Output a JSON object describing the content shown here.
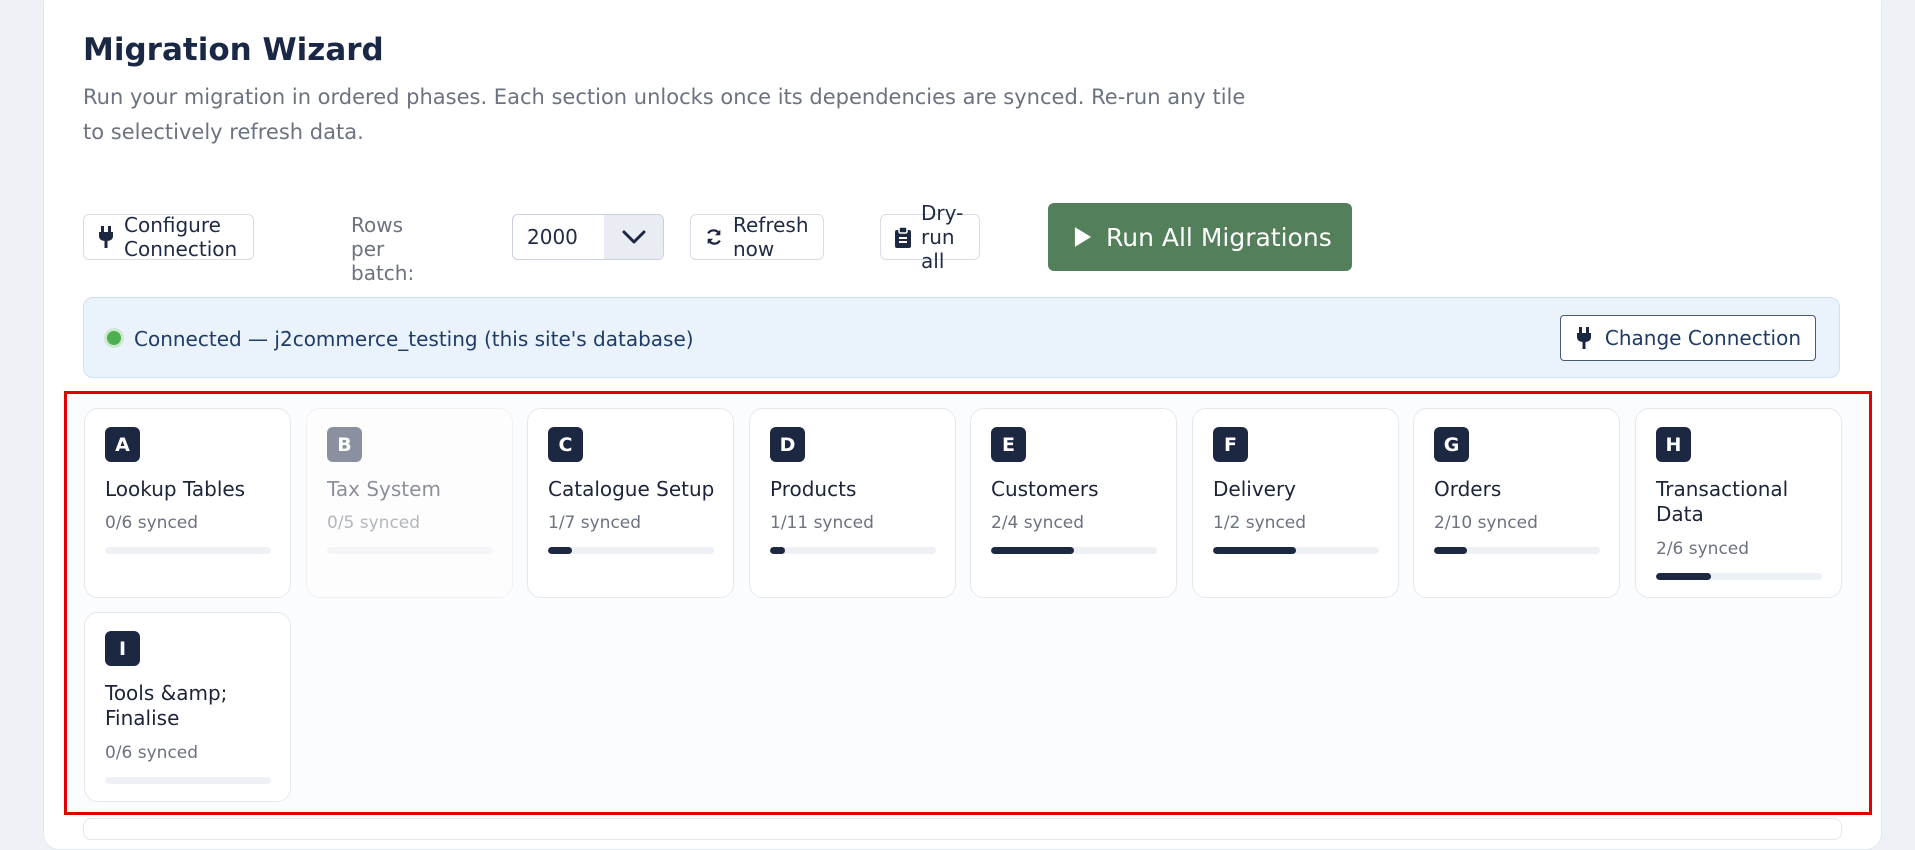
{
  "page": {
    "title": "Migration Wizard",
    "subtitle": "Run your migration in ordered phases. Each section unlocks once its dependencies are synced. Re-run any tile to selectively refresh data."
  },
  "toolbar": {
    "configure_label": "Configure Connection",
    "rows_label": "Rows per batch:",
    "rows_value": "2000",
    "refresh_label": "Refresh now",
    "dryrun_label": "Dry-run all",
    "run_all_label": "Run All Migrations"
  },
  "connection": {
    "status_text": "Connected — j2commerce_testing (this site's database)",
    "change_label": "Change Connection",
    "status_color": "#4caf50"
  },
  "tiles": [
    {
      "letter": "A",
      "name": "Lookup Tables",
      "status": "0/6 synced",
      "progress": 0,
      "enabled": true
    },
    {
      "letter": "B",
      "name": "Tax System",
      "status": "0/5 synced",
      "progress": 0,
      "enabled": false
    },
    {
      "letter": "C",
      "name": "Catalogue Setup",
      "status": "1/7 synced",
      "progress": 0.142857,
      "enabled": true
    },
    {
      "letter": "D",
      "name": "Products",
      "status": "1/11 synced",
      "progress": 0.090909,
      "enabled": true
    },
    {
      "letter": "E",
      "name": "Customers",
      "status": "2/4 synced",
      "progress": 0.5,
      "enabled": true
    },
    {
      "letter": "F",
      "name": "Delivery",
      "status": "1/2 synced",
      "progress": 0.5,
      "enabled": true
    },
    {
      "letter": "G",
      "name": "Orders",
      "status": "2/10 synced",
      "progress": 0.2,
      "enabled": true
    },
    {
      "letter": "H",
      "name": "Transactional Data",
      "status": "2/6 synced",
      "progress": 0.333333,
      "enabled": true
    },
    {
      "letter": "I",
      "name": "Tools &amp; Finalise",
      "status": "0/6 synced",
      "progress": 0,
      "enabled": true
    }
  ],
  "icons": {
    "plug": "plug-icon",
    "chevron": "chevron-down-icon",
    "refresh": "refresh-icon",
    "clipboard": "clipboard-icon",
    "play": "play-icon"
  },
  "colors": {
    "run_button": "#537f5b",
    "badge": "#1c2742",
    "highlight_border": "#e00000"
  }
}
